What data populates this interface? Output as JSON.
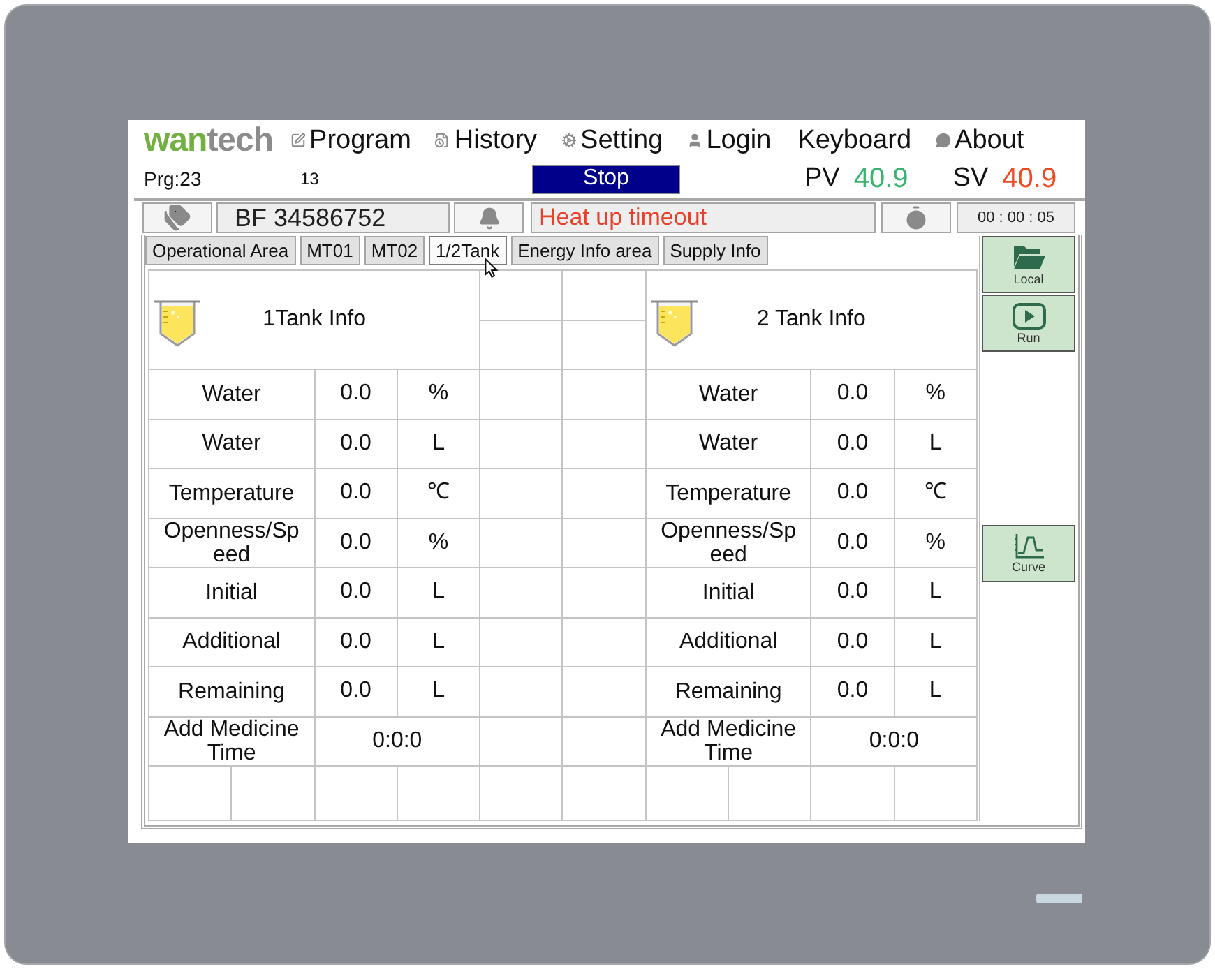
{
  "header": {
    "logo": {
      "part_1": "wan",
      "part_2": "tech"
    },
    "menu": [
      {
        "label": "Program"
      },
      {
        "label": "History"
      },
      {
        "label": "Setting"
      },
      {
        "label": "Login"
      },
      {
        "label": "Keyboard"
      },
      {
        "label": "About"
      }
    ]
  },
  "status": {
    "program": "Prg:23",
    "step": "13",
    "run_state": "Stop",
    "pv": {
      "label": "PV",
      "value": "40.9"
    },
    "sv": {
      "label": "SV",
      "value": "40.9"
    }
  },
  "info_bar": {
    "batch": "BF 34586752",
    "alarm": "Heat up timeout",
    "timer": "00 : 00 : 05"
  },
  "tabs": [
    {
      "label": "Operational Area",
      "selected": false
    },
    {
      "label": "MT01",
      "selected": false
    },
    {
      "label": "MT02",
      "selected": false
    },
    {
      "label": "1/2Tank",
      "selected": true
    },
    {
      "label": "Energy Info area",
      "selected": false
    },
    {
      "label": "Supply Info",
      "selected": false
    }
  ],
  "tanks": [
    {
      "title": "1Tank Info",
      "rows": [
        {
          "label": "Water",
          "value": "0.0",
          "unit": "%"
        },
        {
          "label": "Water",
          "value": "0.0",
          "unit": "L"
        },
        {
          "label": "Temperature",
          "value": "0.0",
          "unit": "℃"
        },
        {
          "label": "Openness/Speed",
          "value": "0.0",
          "unit": "%"
        },
        {
          "label": "Initial",
          "value": "0.0",
          "unit": "L"
        },
        {
          "label": "Additional",
          "value": "0.0",
          "unit": "L"
        },
        {
          "label": "Remaining",
          "value": "0.0",
          "unit": "L"
        }
      ],
      "medicine": {
        "label": "Add Medicine Time",
        "value": "0:0:0"
      }
    },
    {
      "title": "2 Tank Info",
      "rows": [
        {
          "label": "Water",
          "value": "0.0",
          "unit": "%"
        },
        {
          "label": "Water",
          "value": "0.0",
          "unit": "L"
        },
        {
          "label": "Temperature",
          "value": "0.0",
          "unit": "℃"
        },
        {
          "label": "Openness/Speed",
          "value": "0.0",
          "unit": "%"
        },
        {
          "label": "Initial",
          "value": "0.0",
          "unit": "L"
        },
        {
          "label": "Additional",
          "value": "0.0",
          "unit": "L"
        },
        {
          "label": "Remaining",
          "value": "0.0",
          "unit": "L"
        }
      ],
      "medicine": {
        "label": "Add Medicine Time",
        "value": "0:0:0"
      }
    }
  ],
  "side_buttons": [
    {
      "label": "Local"
    },
    {
      "label": "Run"
    },
    {
      "label": "Curve"
    }
  ]
}
